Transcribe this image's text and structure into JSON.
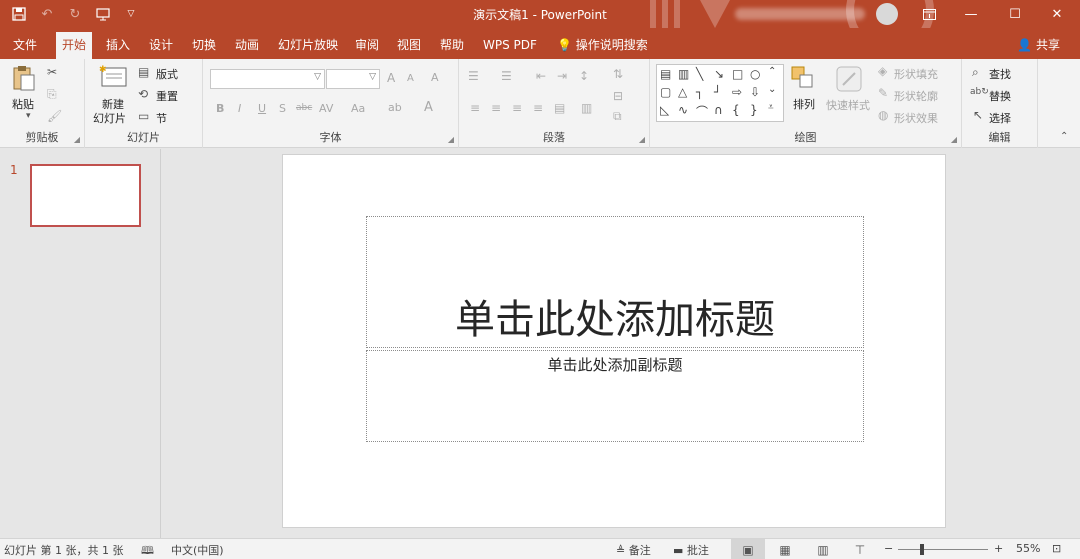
{
  "app": {
    "doc_title": "演示文稿1  -  PowerPoint"
  },
  "qat": {
    "save_icon": "save-icon",
    "undo_icon": "undo-icon",
    "redo_icon": "redo-icon",
    "present_icon": "present-from-start-icon",
    "customize_icon": "customize-qat-icon"
  },
  "window": {
    "ribbon_display_icon": "ribbon-display-options-icon",
    "minimize_glyph": "—",
    "maximize_glyph": "☐",
    "close_glyph": "✕"
  },
  "tabs": [
    {
      "label": "文件"
    },
    {
      "label": "开始"
    },
    {
      "label": "插入"
    },
    {
      "label": "设计"
    },
    {
      "label": "切换"
    },
    {
      "label": "动画"
    },
    {
      "label": "幻灯片放映"
    },
    {
      "label": "审阅"
    },
    {
      "label": "视图"
    },
    {
      "label": "帮助"
    },
    {
      "label": "WPS PDF"
    },
    {
      "label": "操作说明搜索"
    }
  ],
  "share_label": "共享",
  "ribbon": {
    "clipboard": {
      "paste": "粘贴",
      "label": "剪贴板"
    },
    "slides": {
      "new_slide_line1": "新建",
      "new_slide_line2": "幻灯片",
      "layout": "版式",
      "reset": "重置",
      "section": "节",
      "label": "幻灯片"
    },
    "font": {
      "grow": "A",
      "shrink": "A",
      "clear": "A",
      "bold": "B",
      "italic": "I",
      "underline": "U",
      "shadow": "S",
      "strike": "abc",
      "spacing": "AV",
      "case": "Aa",
      "highlight": "ab",
      "color": "A",
      "label": "字体"
    },
    "paragraph": {
      "label": "段落"
    },
    "drawing": {
      "arrange": "排列",
      "quick_styles": "快速样式",
      "shape_fill": "形状填充",
      "shape_outline": "形状轮廓",
      "shape_effects": "形状效果",
      "label": "绘图"
    },
    "editing": {
      "find": "查找",
      "replace": "替换",
      "select": "选择",
      "label": "编辑"
    }
  },
  "thumbnails": [
    {
      "number": "1"
    }
  ],
  "slide": {
    "title_placeholder": "单击此处添加标题",
    "subtitle_placeholder": "单击此处添加副标题"
  },
  "statusbar": {
    "slide_info": "幻灯片 第 1 张，共 1 张",
    "language": "中文(中国)",
    "notes": "备注",
    "comments": "批注",
    "zoom_minus": "−",
    "zoom_plus": "+",
    "zoom_level": "55%"
  },
  "colors": {
    "accent": "#b7472a",
    "ribbon_bg": "#f3f3f3",
    "workspace_bg": "#e6e6e6",
    "thumb_border": "#c0504d"
  }
}
